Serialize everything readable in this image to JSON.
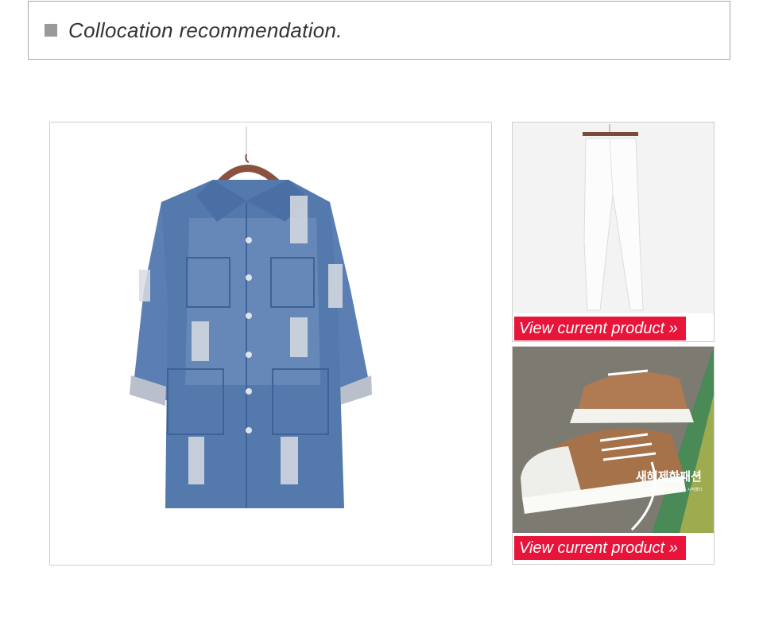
{
  "header": {
    "title": "Collocation recommendation."
  },
  "products": [
    {
      "image": "denim-jacket",
      "link_label": null
    },
    {
      "image": "white-pants",
      "link_label": "View current product »"
    },
    {
      "image": "canvas-sneakers",
      "link_label": "View current product »",
      "image_text": "새해제한패션",
      "image_subtext": "그대는 나와 자체지만 많은 시작했다"
    }
  ],
  "colors": {
    "link_bg": "#e8143a",
    "denim": "#5479ad",
    "border": "#cfcfcf"
  }
}
